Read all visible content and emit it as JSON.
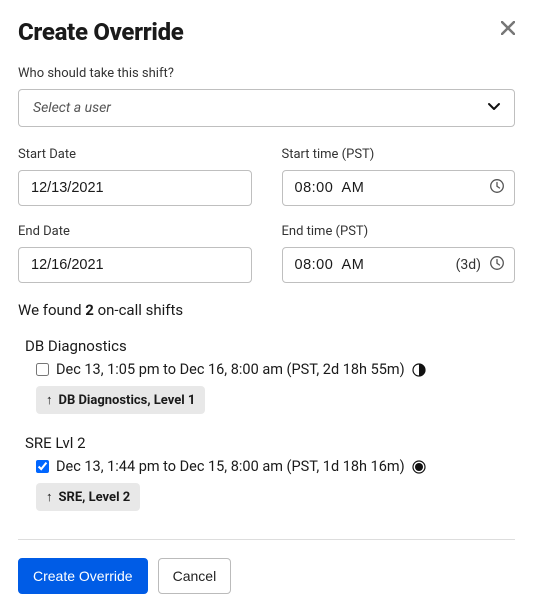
{
  "modal": {
    "title": "Create Override"
  },
  "user_field": {
    "label": "Who should take this shift?",
    "placeholder": "Select a user"
  },
  "start_date": {
    "label": "Start Date",
    "value": "12/13/2021"
  },
  "start_time": {
    "label": "Start time (PST)",
    "value": "08:00  AM"
  },
  "end_date": {
    "label": "End Date",
    "value": "12/16/2021"
  },
  "end_time": {
    "label": "End time (PST)",
    "value": "08:00  AM",
    "duration": "(3d)"
  },
  "found": {
    "prefix": "We found ",
    "count": "2",
    "suffix": " on-call shifts"
  },
  "shifts": [
    {
      "name": "DB Diagnostics",
      "checked": false,
      "time_text": "Dec 13, 1:05 pm to Dec 16, 8:00 am (PST, 2d 18h 55m)",
      "tag_label": "DB Diagnostics, Level 1",
      "icon": "half"
    },
    {
      "name": "SRE Lvl 2",
      "checked": true,
      "time_text": "Dec 13, 1:44 pm to Dec 15, 8:00 am (PST, 1d 18h 16m)",
      "tag_label": "SRE, Level 2",
      "icon": "full"
    }
  ],
  "buttons": {
    "primary": "Create Override",
    "cancel": "Cancel"
  }
}
